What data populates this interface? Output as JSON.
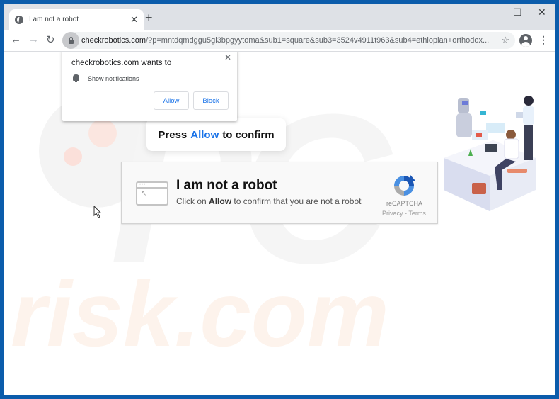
{
  "browser": {
    "tab": {
      "title": "I am not a robot",
      "favicon": "globe-icon",
      "close": "✕"
    },
    "new_tab": "+",
    "window_controls": {
      "minimize": "—",
      "maximize": "☐",
      "close": "✕"
    },
    "nav": {
      "back": "←",
      "forward": "→",
      "reload": "↻"
    },
    "address": {
      "domain": "checkrobotics.com",
      "rest": "/?p=mntdqmdggu5gi3bpgyytoma&sub1=square&sub3=3524v4911t963&sub4=ethiopian+orthodox..."
    },
    "bookmark": "☆",
    "menu": "⋮"
  },
  "notification_prompt": {
    "title": "checkrobotics.com wants to",
    "permission": "Show notifications",
    "allow": "Allow",
    "block": "Block",
    "close": "✕"
  },
  "press_box": {
    "before": "Press",
    "highlight": "Allow",
    "after": "to confirm"
  },
  "captcha": {
    "title": "I am not a robot",
    "sub_before": "Click on",
    "sub_bold": "Allow",
    "sub_after": "to confirm that you are not a robot",
    "brand": "reCAPTCHA",
    "links": "Privacy - Terms",
    "window_dots": "•••",
    "window_arrow": "↖"
  },
  "watermark": {
    "top": "PC",
    "bottom": "risk.com"
  },
  "colors": {
    "accent": "#1a73e8",
    "frame": "#0b5cab"
  }
}
